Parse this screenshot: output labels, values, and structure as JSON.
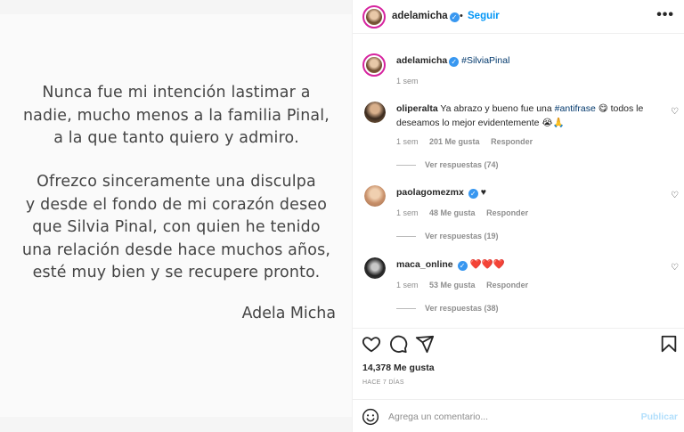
{
  "post": {
    "statement_lines_1": [
      "Nunca fue mi intención lastimar a",
      "nadie, mucho menos a la familia Pinal,",
      "a la que tanto quiero y admiro."
    ],
    "statement_lines_2": [
      "Ofrezco sinceramente una disculpa",
      "y desde el fondo de mi corazón deseo",
      "que Silvia Pinal, con quien he tenido",
      "una relación desde hace muchos años,",
      "esté muy bien y se recupere pronto."
    ],
    "signature": "Adela Micha"
  },
  "header": {
    "username": "adelamicha",
    "dot": "•",
    "follow_label": "Seguir",
    "more_icon": "•••"
  },
  "caption": {
    "username": "adelamicha",
    "hashtag": "#SilviaPinal",
    "time": "1 sem"
  },
  "comments": [
    {
      "username": "oliperalta",
      "text_a": "Ya abrazo y bueno fue una ",
      "hashtag": "#antifrase",
      "text_b": " 😋 todos le deseamos lo mejor evidentemente 😭🙏",
      "time": "1 sem",
      "likes": "201 Me gusta",
      "reply": "Responder",
      "view_replies": "Ver respuestas (74)"
    },
    {
      "username": "paolagomezmx",
      "text": "♥",
      "time": "1 sem",
      "likes": "48 Me gusta",
      "reply": "Responder",
      "view_replies": "Ver respuestas (19)"
    },
    {
      "username": "maca_online",
      "text": "❤️❤️❤️",
      "time": "1 sem",
      "likes": "53 Me gusta",
      "reply": "Responder",
      "view_replies": "Ver respuestas (38)"
    }
  ],
  "actions": {
    "likes": "14,378 Me gusta",
    "ago": "HACE 7 DÍAS"
  },
  "add_comment": {
    "placeholder": "Agrega un comentario...",
    "publish_label": "Publicar"
  },
  "colors": {
    "accent": "#0095f6",
    "verified": "#3897f0",
    "story_ring": "#d6249f"
  }
}
